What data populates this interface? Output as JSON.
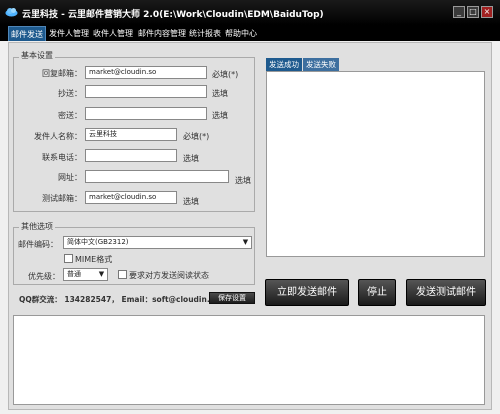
{
  "window": {
    "title": "云里科技 - 云里邮件营销大师 2.0(E:\\Work\\Cloudin\\EDM\\BaiduTop)",
    "minimize": "_",
    "maximize": "□",
    "close": "×"
  },
  "menu": [
    "邮件发送",
    "发件人管理",
    "收件人管理",
    "邮件内容管理",
    "统计报表",
    "帮助中心"
  ],
  "basic": {
    "legend": "基本设置",
    "fields": [
      {
        "label": "回复邮箱：",
        "value": "market@cloudin.so",
        "hint": "必填(*)"
      },
      {
        "label": "抄送：",
        "value": "",
        "hint": "选填"
      },
      {
        "label": "密送：",
        "value": "",
        "hint": "选填"
      },
      {
        "label": "发件人名称：",
        "value": "云里科技",
        "hint": "必填(*)"
      },
      {
        "label": "联系电话：",
        "value": "",
        "hint": "选填"
      },
      {
        "label": "网址：",
        "value": "",
        "hint": "选填"
      },
      {
        "label": "测试邮箱：",
        "value": "market@cloudin.so",
        "hint": "选填"
      }
    ]
  },
  "other": {
    "legend": "其他选项",
    "encoding_label": "邮件编码：",
    "encoding_value": "简体中文(GB2312)",
    "mime_label": "MIME格式",
    "priority_label": "优先级：",
    "priority_value": "普通",
    "receipt_label": "要求对方发送阅读状态"
  },
  "contact": {
    "text": "QQ群交流： 134282547， Email：soft@cloudin.so",
    "save_button": "保存设置"
  },
  "tabs": {
    "success": "发送成功",
    "failed": "发送失败"
  },
  "actions": {
    "send": "立即发送邮件",
    "stop": "停止",
    "test": "发送测试邮件"
  }
}
